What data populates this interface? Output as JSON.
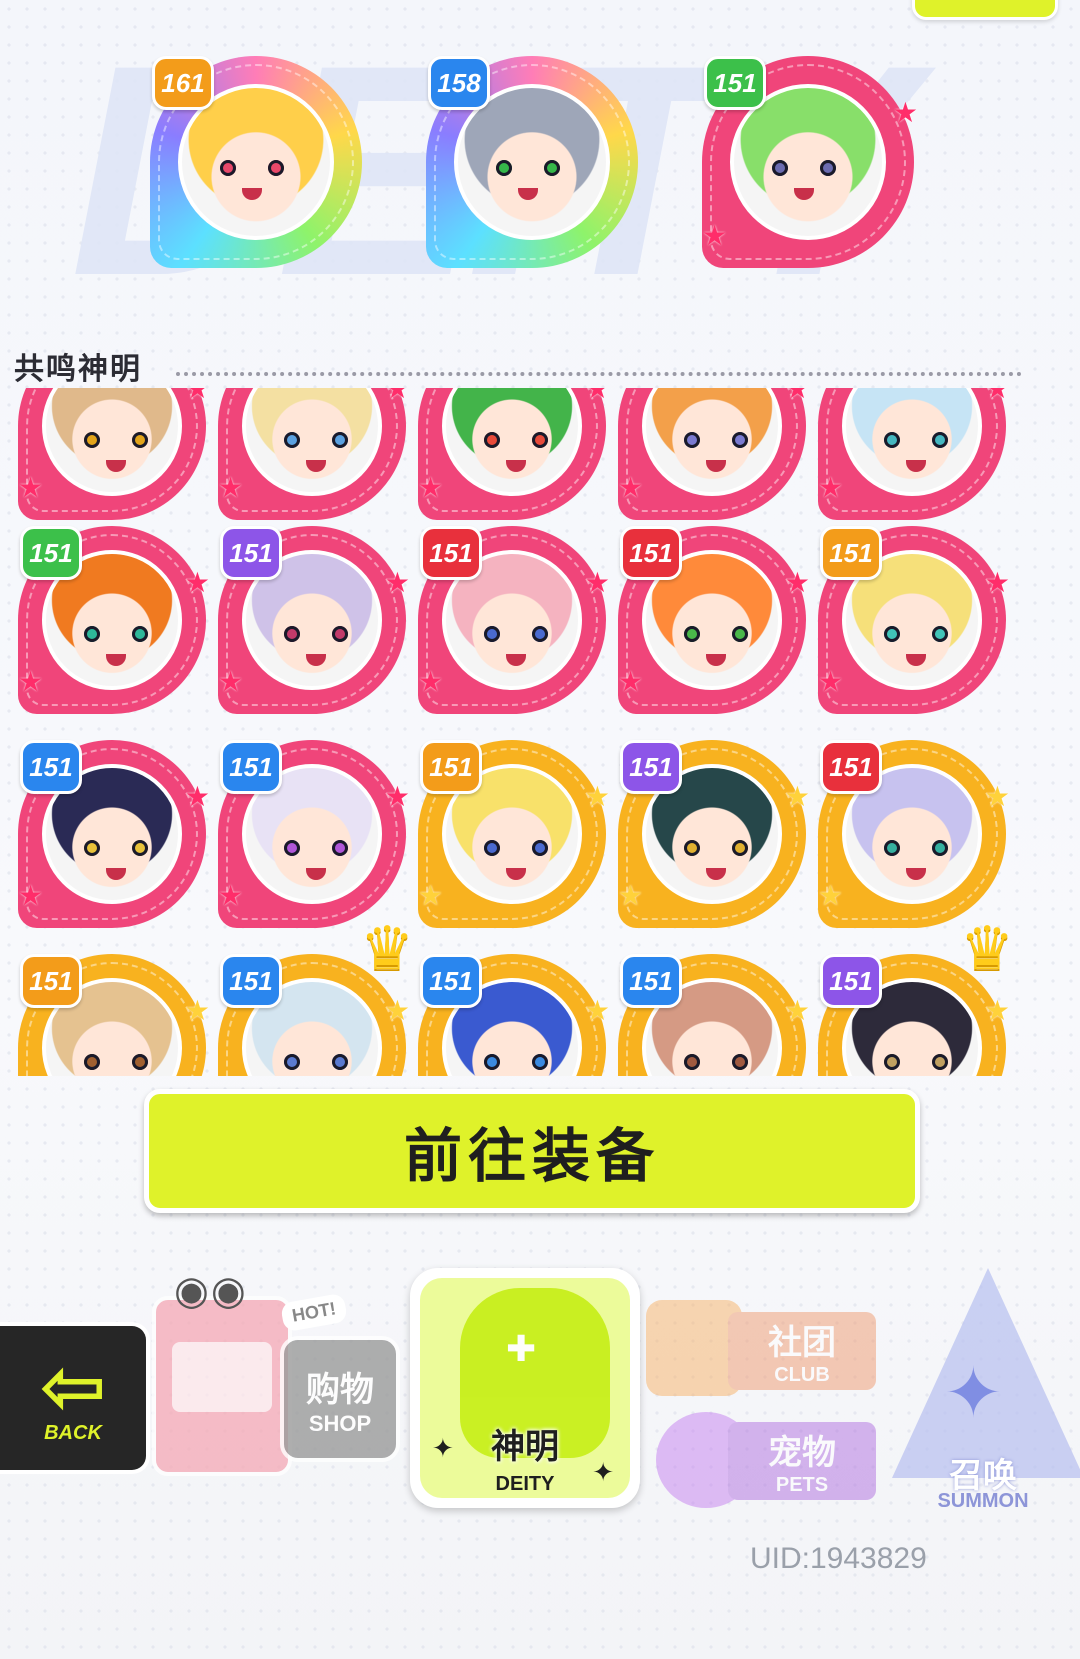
{
  "bg_word": "DEITY",
  "section": {
    "title": "共鸣神明"
  },
  "featured": [
    {
      "level": "161",
      "ring": "rainbow",
      "badge_color": "orange",
      "hair": "#ffcf4a",
      "eye": "#e8486a"
    },
    {
      "level": "158",
      "ring": "rainbow",
      "badge_color": "blue",
      "hair": "#9ea6b8",
      "eye": "#35b84a"
    },
    {
      "level": "151",
      "ring": "pink",
      "badge_color": "green",
      "hair": "#88df6a",
      "eye": "#6b6bb0"
    }
  ],
  "grid": [
    [
      {
        "level": "",
        "ring": "pink",
        "hair": "#e0b98b",
        "eye": "#e2a41a"
      },
      {
        "level": "",
        "ring": "pink",
        "hair": "#f4e0a2",
        "eye": "#5ba1e0"
      },
      {
        "level": "",
        "ring": "pink",
        "hair": "#43b44a",
        "eye": "#e84a3a"
      },
      {
        "level": "",
        "ring": "pink",
        "hair": "#f3a04a",
        "eye": "#7a7ad0"
      },
      {
        "level": "",
        "ring": "pink",
        "hair": "#c6e4f5",
        "eye": "#45b7c0"
      }
    ],
    [
      {
        "level": "151",
        "ring": "pink",
        "badge_color": "green",
        "hair": "#f07a20",
        "eye": "#2eb89a"
      },
      {
        "level": "151",
        "ring": "pink",
        "badge_color": "purple",
        "hair": "#cfc2e8",
        "eye": "#c23a6a"
      },
      {
        "level": "151",
        "ring": "pink",
        "badge_color": "red",
        "hair": "#f5b3c0",
        "eye": "#4a6ad0"
      },
      {
        "level": "151",
        "ring": "pink",
        "badge_color": "red",
        "hair": "#ff8a3a",
        "eye": "#4ab84a"
      },
      {
        "level": "151",
        "ring": "pink",
        "badge_color": "orange",
        "hair": "#f6e07a",
        "eye": "#40c4b8"
      }
    ],
    [
      {
        "level": "151",
        "ring": "pink",
        "badge_color": "blue",
        "hair": "#2a2a55",
        "eye": "#e8c23a"
      },
      {
        "level": "151",
        "ring": "pink",
        "badge_color": "blue",
        "hair": "#e8e2f5",
        "eye": "#b056d8"
      },
      {
        "level": "151",
        "ring": "gold",
        "badge_color": "orange",
        "hair": "#f8e16a",
        "eye": "#4a6ad0"
      },
      {
        "level": "151",
        "ring": "gold",
        "badge_color": "purple",
        "hair": "#26474a",
        "eye": "#e0b030"
      },
      {
        "level": "151",
        "ring": "gold",
        "badge_color": "red",
        "hair": "#c7c2ef",
        "eye": "#35b0a0"
      }
    ],
    [
      {
        "level": "151",
        "ring": "gold",
        "badge_color": "orange",
        "hair": "#e5c290",
        "eye": "#a06030"
      },
      {
        "level": "151",
        "ring": "gold",
        "badge_color": "blue",
        "hair": "#d4e5f0",
        "eye": "#5a7ad0",
        "crown": true
      },
      {
        "level": "151",
        "ring": "gold",
        "badge_color": "blue",
        "hair": "#3a5ad0",
        "eye": "#3a8ae0"
      },
      {
        "level": "151",
        "ring": "gold",
        "badge_color": "blue",
        "hair": "#d59a84",
        "eye": "#a05a40"
      },
      {
        "level": "151",
        "ring": "gold",
        "badge_color": "purple",
        "hair": "#2d2a3a",
        "eye": "#c0a060",
        "crown": true
      }
    ]
  ],
  "equip_button": {
    "label": "前往装备"
  },
  "nav": {
    "back": {
      "label": "BACK"
    },
    "shop": {
      "cn": "购物",
      "en": "SHOP",
      "hot": "HOT!"
    },
    "deity": {
      "cn": "神明",
      "en": "DEITY"
    },
    "club": {
      "cn": "社团",
      "en": "CLUB"
    },
    "pets": {
      "cn": "宠物",
      "en": "PETS"
    },
    "summon": {
      "cn": "召唤",
      "en": "SUMMON"
    }
  },
  "uid": "UID:1943829"
}
